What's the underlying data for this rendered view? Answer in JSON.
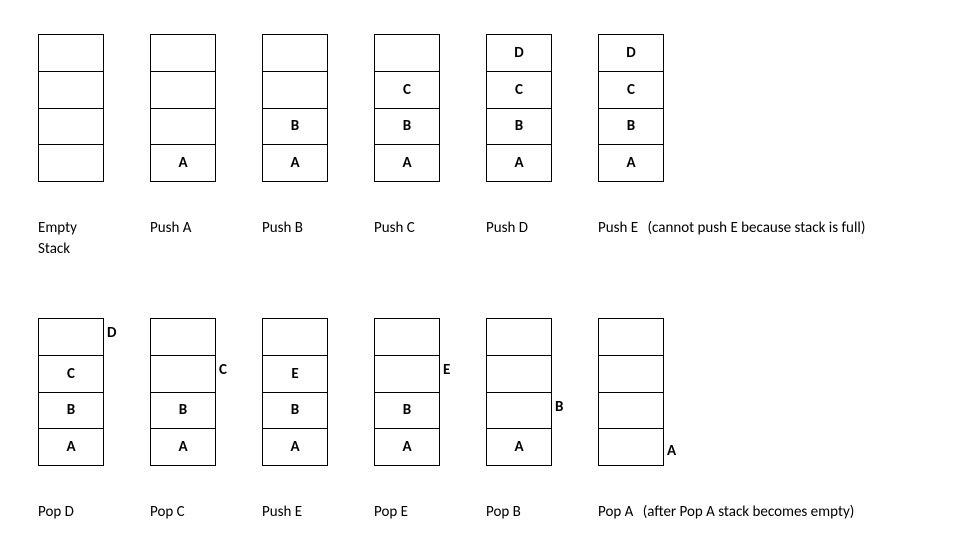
{
  "topRow": {
    "stacks": [
      {
        "cells": [
          "",
          "",
          "",
          ""
        ],
        "popped": null
      },
      {
        "cells": [
          "A",
          "",
          "",
          ""
        ],
        "popped": null
      },
      {
        "cells": [
          "A",
          "B",
          "",
          ""
        ],
        "popped": null
      },
      {
        "cells": [
          "A",
          "B",
          "C",
          ""
        ],
        "popped": null
      },
      {
        "cells": [
          "A",
          "B",
          "C",
          "D"
        ],
        "popped": null
      },
      {
        "cells": [
          "A",
          "B",
          "C",
          "D"
        ],
        "popped": null
      }
    ],
    "labels": [
      {
        "line1": "Empty",
        "line2": "Stack",
        "extra": ""
      },
      {
        "line1": "Push A",
        "line2": "",
        "extra": ""
      },
      {
        "line1": "Push B",
        "line2": "",
        "extra": ""
      },
      {
        "line1": "Push C",
        "line2": "",
        "extra": ""
      },
      {
        "line1": "Push D",
        "line2": "",
        "extra": ""
      },
      {
        "line1": "Push E",
        "line2": "",
        "extra": "(cannot push E because stack is full)"
      }
    ]
  },
  "botRow": {
    "stacks": [
      {
        "cells": [
          "A",
          "B",
          "C",
          ""
        ],
        "popped": {
          "text": "D",
          "slot": 3
        }
      },
      {
        "cells": [
          "A",
          "B",
          "",
          ""
        ],
        "popped": {
          "text": "C",
          "slot": 2
        }
      },
      {
        "cells": [
          "A",
          "B",
          "E",
          ""
        ],
        "popped": null
      },
      {
        "cells": [
          "A",
          "B",
          "",
          ""
        ],
        "popped": {
          "text": "E",
          "slot": 2
        }
      },
      {
        "cells": [
          "A",
          "",
          "",
          ""
        ],
        "popped": {
          "text": "B",
          "slot": 1
        }
      },
      {
        "cells": [
          "",
          "",
          "",
          ""
        ],
        "popped": {
          "text": "A",
          "slot": 0
        }
      }
    ],
    "labels": [
      {
        "line1": "Pop D",
        "line2": "",
        "extra": ""
      },
      {
        "line1": "Pop C",
        "line2": "",
        "extra": ""
      },
      {
        "line1": "Push E",
        "line2": "",
        "extra": ""
      },
      {
        "line1": "Pop E",
        "line2": "",
        "extra": ""
      },
      {
        "line1": "Pop B",
        "line2": "",
        "extra": ""
      },
      {
        "line1": "Pop A",
        "line2": "",
        "extra": "(after Pop A stack becomes empty)"
      }
    ]
  }
}
